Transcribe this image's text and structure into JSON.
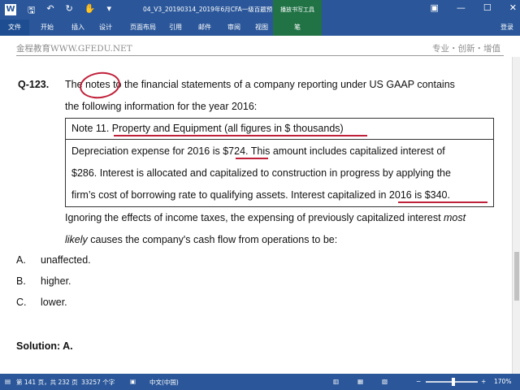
{
  "window": {
    "title": "04_V3_20190314_2019年6月CFA一级百题预...",
    "context_tab_header": "播放书写工具",
    "controls": [
      "☐",
      "—",
      "☐",
      "✕"
    ]
  },
  "qat_icons": [
    "save-icon",
    "undo-icon",
    "redo-icon",
    "touch-mode-icon",
    "customize-icon"
  ],
  "ribbon": {
    "tabs": [
      "文件",
      "开始",
      "插入",
      "设计",
      "页面布局",
      "引用",
      "邮件",
      "审阅",
      "视图"
    ],
    "context_tab": "笔",
    "login": "登录"
  },
  "doc_header": {
    "left": "金程教育WWW.GFEDU.NET",
    "right": "专业・创新・增值"
  },
  "document": {
    "question_label": "Q-123.",
    "q_line1": "The notes to the financial statements of a company reporting under US GAAP contains",
    "q_line2": "the following information for the year 2016:",
    "note_title": "Note 11. Property and Equipment (all figures in $ thousands)",
    "note_line1": "Depreciation expense for 2016 is $724. This amount includes capitalized interest of",
    "note_line2": "$286.    Interest is allocated and capitalized to construction in progress by applying the",
    "note_line3": "firm’s cost of borrowing rate to qualifying assets. Interest capitalized in 2016 is $340.",
    "after_line1_pre": "Ignoring the effects of income taxes, the expensing of previously capitalized interest ",
    "after_line1_em": "most",
    "after_line2_em": "likely",
    "after_line2_post": " causes the company's cash flow from operations to be:",
    "choices": [
      {
        "letter": "A.",
        "text": "unaffected."
      },
      {
        "letter": "B.",
        "text": "higher."
      },
      {
        "letter": "C.",
        "text": "lower."
      }
    ],
    "solution": "Solution: A."
  },
  "status": {
    "page": "第 141 页，共 232 页",
    "words": "33257 个字",
    "lang": "中文(中国)",
    "zoom": "170%"
  }
}
